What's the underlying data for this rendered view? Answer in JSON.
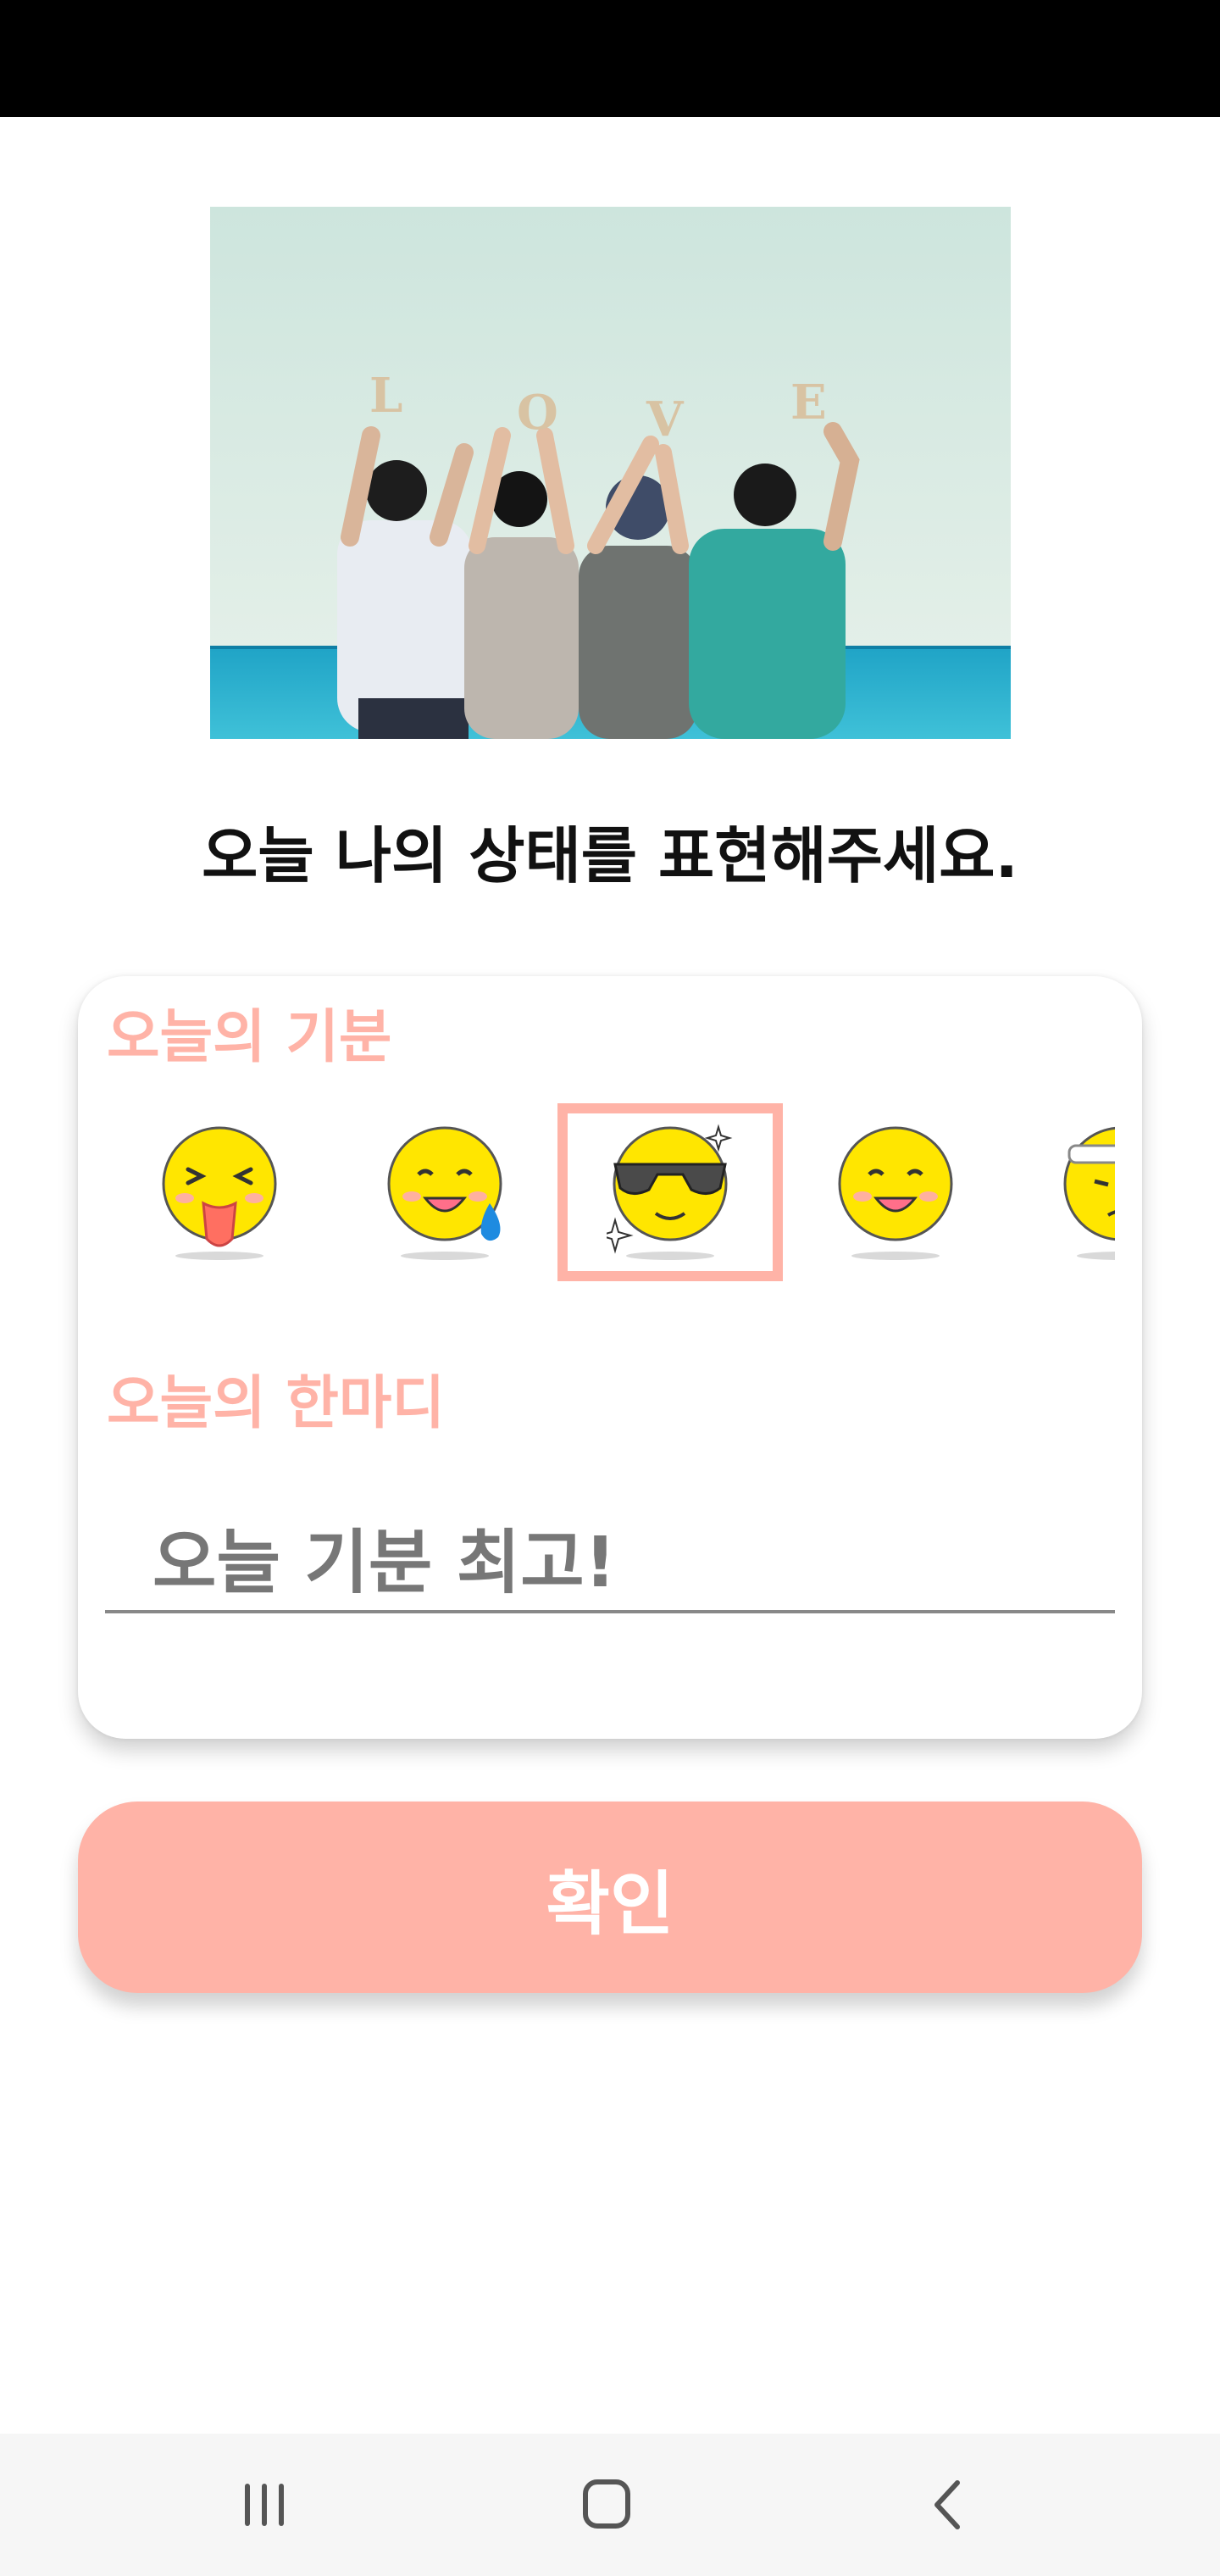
{
  "headline": "오늘 나의 상태를 표현해주세요.",
  "photo": {
    "letters": [
      "L",
      "O",
      "V",
      "E"
    ]
  },
  "mood": {
    "label": "오늘의 기분",
    "emojis": [
      {
        "icon": "tongue-out-emoji-icon",
        "selected": false
      },
      {
        "icon": "sweat-smile-emoji-icon",
        "selected": false
      },
      {
        "icon": "sunglasses-emoji-icon",
        "selected": true
      },
      {
        "icon": "smile-emoji-icon",
        "selected": false
      },
      {
        "icon": "headband-emoji-icon",
        "selected": false
      }
    ]
  },
  "comment": {
    "label": "오늘의 한마디",
    "value": "오늘 기분 최고!"
  },
  "confirm_label": "확인",
  "nav": {
    "recent": "recent-apps-icon",
    "home": "home-icon",
    "back": "back-icon"
  },
  "colors": {
    "accent": "#ffb3a7",
    "status_bar": "#000000",
    "nav_bar": "#f6f6f6",
    "emoji_yellow": "#ffe600"
  }
}
